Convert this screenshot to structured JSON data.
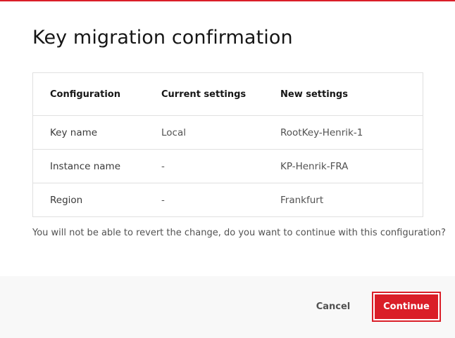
{
  "modal": {
    "title": "Key migration confirmation",
    "accent_color": "#da1e28"
  },
  "table": {
    "headers": [
      "Configuration",
      "Current settings",
      "New settings"
    ],
    "rows": [
      [
        "Key name",
        "Local",
        "RootKey-Henrik-1"
      ],
      [
        "Instance name",
        "-",
        "KP-Henrik-FRA"
      ],
      [
        "Region",
        "-",
        "Frankfurt"
      ]
    ]
  },
  "warning_text": "You will not be able to revert the change, do you want to continue with this configuration?",
  "footer": {
    "cancel_label": "Cancel",
    "continue_label": "Continue"
  }
}
